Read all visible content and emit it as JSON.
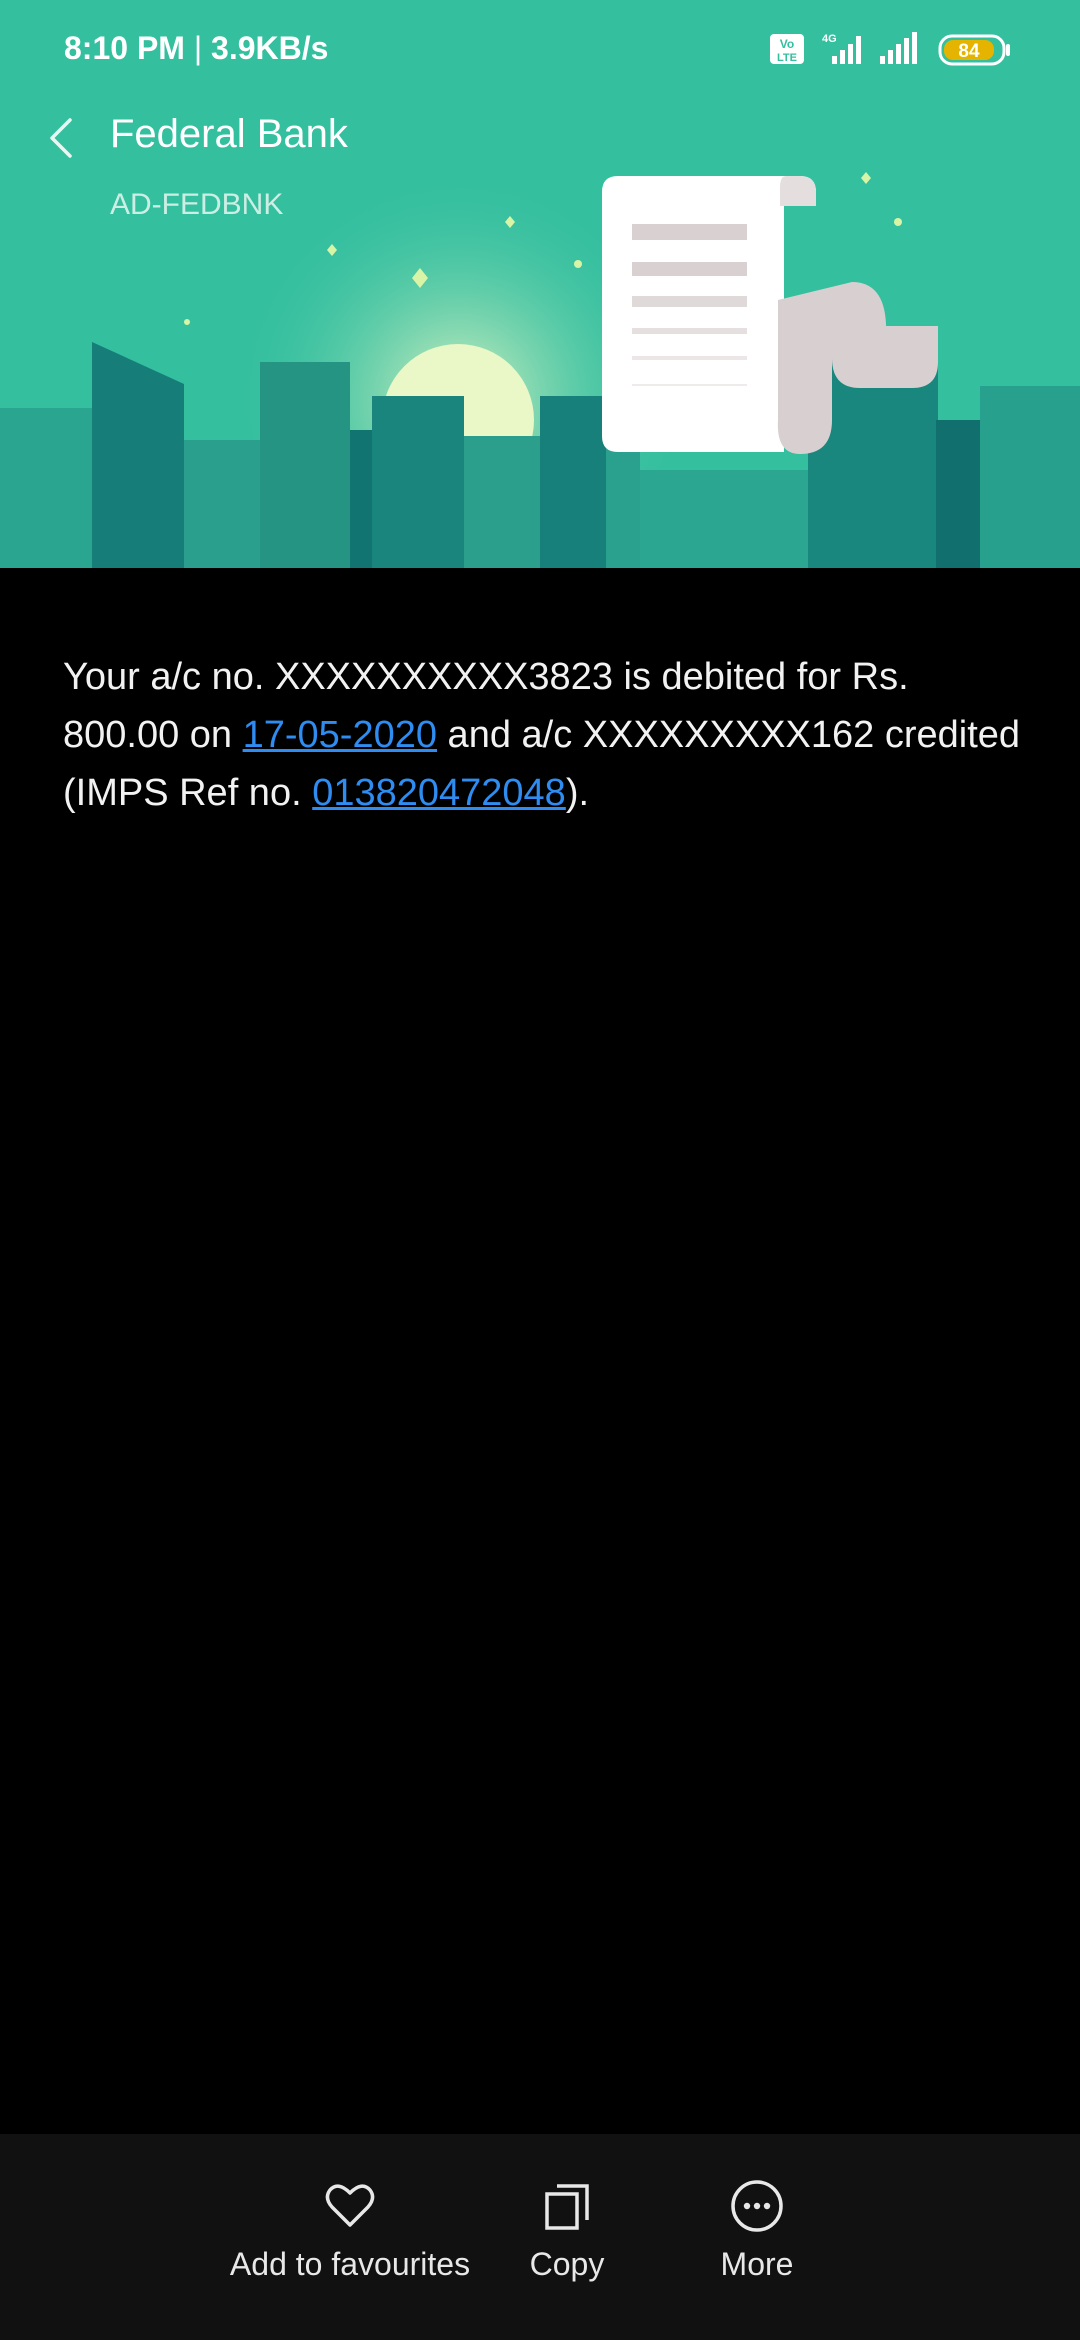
{
  "status_bar": {
    "time": "8:10 PM",
    "speed": "3.9KB/s",
    "network_type": "4G",
    "volte_label": "Vo LTE",
    "battery": "84"
  },
  "header": {
    "title": "Federal Bank",
    "sender_id": "AD-FEDBNK",
    "back_icon": "chevron-left-icon",
    "bg_color": "#34bf9f"
  },
  "message": {
    "part1": "Your a/c no. XXXXXXXXXX3823 is debited for Rs. 800.00 on ",
    "date_link": "17-05-2020",
    "part2": " and a/c XXXXXXXXX162 credited (IMPS Ref no. ",
    "ref_link": "013820472048",
    "part3": ").",
    "link_color": "#2f8cf0"
  },
  "actions": [
    {
      "label": "Add to favourites",
      "icon": "heart-icon"
    },
    {
      "label": "Copy",
      "icon": "copy-icon"
    },
    {
      "label": "More",
      "icon": "more-icon"
    }
  ]
}
